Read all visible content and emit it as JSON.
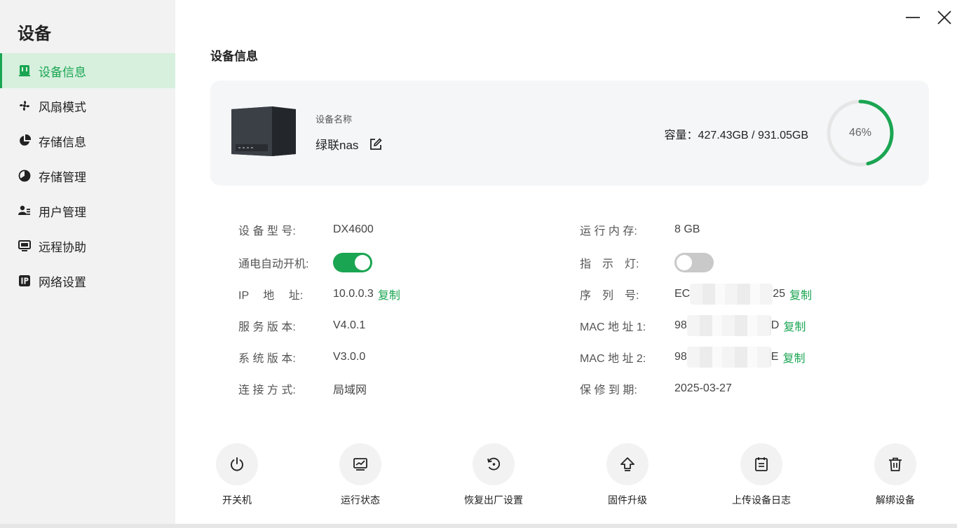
{
  "sidebar": {
    "title": "设备",
    "items": [
      {
        "label": "设备信息",
        "icon": "device-info-icon",
        "active": true
      },
      {
        "label": "风扇模式",
        "icon": "fan-icon",
        "active": false
      },
      {
        "label": "存储信息",
        "icon": "storage-info-icon",
        "active": false
      },
      {
        "label": "存储管理",
        "icon": "storage-manage-icon",
        "active": false
      },
      {
        "label": "用户管理",
        "icon": "user-manage-icon",
        "active": false
      },
      {
        "label": "远程协助",
        "icon": "remote-assist-icon",
        "active": false
      },
      {
        "label": "网络设置",
        "icon": "ip-icon",
        "active": false
      }
    ]
  },
  "window": {
    "minimize_icon": "minimize-icon",
    "close_icon": "close-icon"
  },
  "page": {
    "title": "设备信息"
  },
  "device": {
    "name_label": "设备名称",
    "name": "绿联nas",
    "capacity": "容量：427.43GB / 931.05GB",
    "usage_percent": 46,
    "usage_text": "46%"
  },
  "info": {
    "model_label": "设 备 型 号:",
    "model_value": "DX4600",
    "memory_label": "运 行 内 存:",
    "memory_value": "8 GB",
    "autopower_label": "通电自动开机:",
    "autopower_on": true,
    "indicator_label": "指　示　灯:",
    "indicator_on": false,
    "ip_label": "IP　 地　 址:",
    "ip_value": "10.0.0.3",
    "serial_label": "序　列　号:",
    "serial_prefix": "EC",
    "serial_suffix": "25",
    "service_label": "服 务 版 本:",
    "service_value": "V4.0.1",
    "mac1_label": "MAC 地 址 1:",
    "mac1_prefix": "98",
    "mac1_suffix": "D",
    "system_label": "系 统 版 本:",
    "system_value": "V3.0.0",
    "mac2_label": "MAC 地 址 2:",
    "mac2_prefix": "98",
    "mac2_suffix": "E",
    "connect_label": "连 接 方 式:",
    "connect_value": "局域网",
    "warranty_label": "保 修 到 期:",
    "warranty_value": "2025-03-27",
    "copy_label": "复制"
  },
  "actions": [
    {
      "label": "开关机",
      "icon": "power-icon"
    },
    {
      "label": "运行状态",
      "icon": "monitor-chart-icon"
    },
    {
      "label": "恢复出厂设置",
      "icon": "restore-icon"
    },
    {
      "label": "固件升级",
      "icon": "upgrade-icon"
    },
    {
      "label": "上传设备日志",
      "icon": "log-icon"
    },
    {
      "label": "解绑设备",
      "icon": "trash-icon"
    }
  ],
  "colors": {
    "accent": "#1aa552",
    "active_bg": "#d6f0dd",
    "sidebar_bg": "#f2f2f2",
    "card_bg": "#f5f6f8"
  }
}
